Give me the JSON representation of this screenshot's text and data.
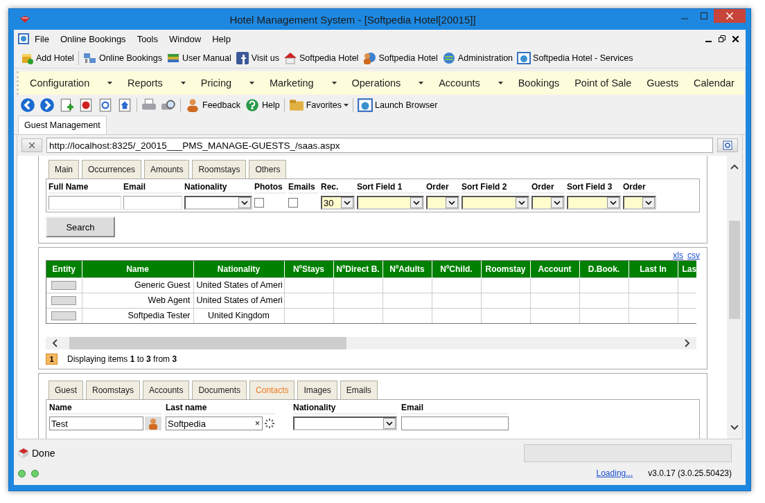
{
  "window": {
    "title": "Hotel Management System - [Softpedia Hotel[20015]]"
  },
  "menu": [
    "File",
    "Online Bookings",
    "Tools",
    "Window",
    "Help"
  ],
  "toolbar": [
    {
      "label": "Add Hotel"
    },
    {
      "label": "Online Bookings"
    },
    {
      "label": "User Manual"
    },
    {
      "label": "Visit us"
    },
    {
      "label": "Softpedia Hotel"
    },
    {
      "label": "Softpedia Hotel"
    },
    {
      "label": "Administration"
    },
    {
      "label": "Softpedia Hotel - Services"
    }
  ],
  "nav": [
    {
      "label": "Configuration",
      "dropdown": true
    },
    {
      "label": "Reports",
      "dropdown": true
    },
    {
      "label": "Pricing",
      "dropdown": true
    },
    {
      "label": "Marketing",
      "dropdown": true
    },
    {
      "label": "Operations",
      "dropdown": true
    },
    {
      "label": "Accounts",
      "dropdown": true
    },
    {
      "label": "Bookings",
      "dropdown": false
    },
    {
      "label": "Point of Sale",
      "dropdown": false
    },
    {
      "label": "Guests",
      "dropdown": false
    },
    {
      "label": "Calendar",
      "dropdown": false
    }
  ],
  "actions": [
    {
      "label": "Feedback",
      "dropdown": false
    },
    {
      "label": "Help",
      "dropdown": false
    },
    {
      "label": "Favorites",
      "dropdown": true
    },
    {
      "label": "Launch Browser",
      "dropdown": false
    }
  ],
  "doc_tab": {
    "label": "Guest Management"
  },
  "address": {
    "value": "http://localhost:8325/_20015___PMS_MANAGE-GUESTS_/saas.aspx"
  },
  "filter_tabs": [
    {
      "label": "Main",
      "selected": false
    },
    {
      "label": "Occurrences",
      "selected": false
    },
    {
      "label": "Amounts",
      "selected": false
    },
    {
      "label": "Roomstays",
      "selected": false
    },
    {
      "label": "Others",
      "selected": false
    }
  ],
  "filters": [
    {
      "label": "Full Name",
      "kind": "text"
    },
    {
      "label": "Email",
      "kind": "text"
    },
    {
      "label": "Nationality",
      "kind": "select",
      "highlighted": false
    },
    {
      "label": "Photos",
      "kind": "checkbox",
      "checked": false
    },
    {
      "label": "Emails",
      "kind": "checkbox",
      "checked": false
    },
    {
      "label": "Rec.",
      "kind": "select",
      "value": "30",
      "highlighted": true
    },
    {
      "label": "Sort Field 1",
      "kind": "select",
      "highlighted": true
    },
    {
      "label": "Order",
      "kind": "select",
      "highlighted": true
    },
    {
      "label": "Sort Field 2",
      "kind": "select",
      "highlighted": true
    },
    {
      "label": "Order",
      "kind": "select",
      "highlighted": true
    },
    {
      "label": "Sort Field 3",
      "kind": "select",
      "highlighted": true
    },
    {
      "label": "Order",
      "kind": "select",
      "highlighted": true
    }
  ],
  "search_button": "Search",
  "grid": {
    "export_links": [
      "xls",
      "csv"
    ],
    "columns": [
      "Entity",
      "Name",
      "Nationality",
      "NºStays",
      "NºDirect B.",
      "NºAdults",
      "NºChild.",
      "Roomstay",
      "Account",
      "D.Book.",
      "Last In",
      "Las"
    ],
    "rows": [
      {
        "name": "Generic Guest",
        "nationality": "United States of Ameri"
      },
      {
        "name": "Web Agent",
        "nationality": "United States of Ameri"
      },
      {
        "name": "Softpedia Tester",
        "nationality": "United Kingdom"
      }
    ],
    "pager": {
      "page": "1",
      "text": "Displaying items **1** to **3** from **3**"
    }
  },
  "detail_tabs": [
    {
      "label": "Guest",
      "selected": false
    },
    {
      "label": "Roomstays",
      "selected": false
    },
    {
      "label": "Accounts",
      "selected": false
    },
    {
      "label": "Documents",
      "selected": false
    },
    {
      "label": "Contacts",
      "selected": true
    },
    {
      "label": "Images",
      "selected": false
    },
    {
      "label": "Emails",
      "selected": false
    }
  ],
  "contact_fields": [
    {
      "label": "Name",
      "kind": "lookup",
      "value": "Test"
    },
    {
      "label": "Last name",
      "kind": "text",
      "value": "Softpedia",
      "clear": "×"
    },
    {
      "label": "Nationality",
      "kind": "select"
    },
    {
      "label": "Email",
      "kind": "text"
    }
  ],
  "status": {
    "text": "Done"
  },
  "footer": {
    "link": "Loading...",
    "version": "v3.0.17 (3.0.25.50423)"
  }
}
